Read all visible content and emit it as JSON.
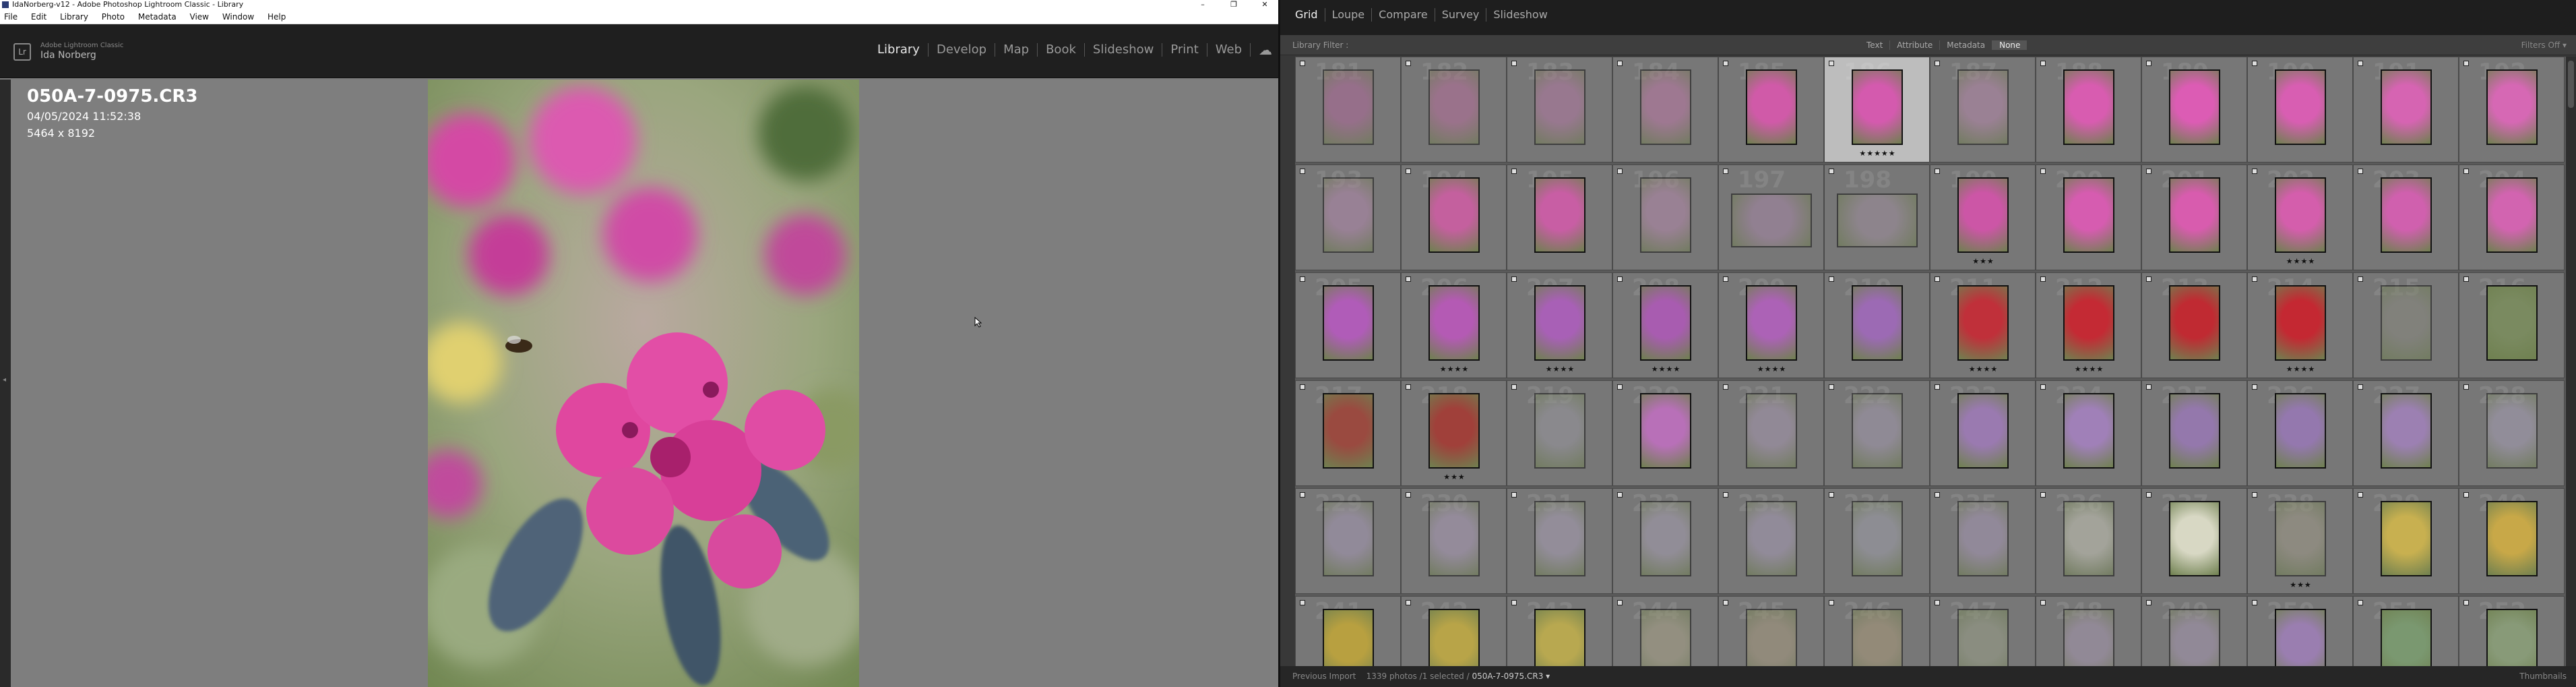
{
  "left_window": {
    "title": "IdaNorberg-v12 - Adobe Photoshop Lightroom Classic - Library",
    "window_buttons": [
      "–",
      "❐",
      "✕"
    ],
    "menu": [
      "File",
      "Edit",
      "Library",
      "Photo",
      "Metadata",
      "View",
      "Window",
      "Help"
    ],
    "identity": {
      "logo": "Lr",
      "sub": "Adobe Lightroom Classic",
      "name": "Ida Norberg"
    },
    "modules": [
      "Library",
      "Develop",
      "Map",
      "Book",
      "Slideshow",
      "Print",
      "Web"
    ],
    "active_module": "Library",
    "cloud_icon": "☁",
    "loupe": {
      "filename": "050A-7-0975.CR3",
      "datetime": "04/05/2024 11:52:38",
      "dimensions": "5464 x 8192"
    }
  },
  "right_window": {
    "view_tabs": [
      "Grid",
      "Loupe",
      "Compare",
      "Survey",
      "Slideshow"
    ],
    "active_view": "Grid",
    "filter_bar": {
      "label": "Library Filter :",
      "options": [
        "Text",
        "Attribute",
        "Metadata",
        "None"
      ],
      "active": "None",
      "right": "Filters Off ▾"
    },
    "status": {
      "source": "Previous Import",
      "count": "1339 photos /1 selected /",
      "file": "050A-7-0975.CR3 ▾"
    },
    "thumbnails_label": "Thumbnails",
    "rows": [
      [
        {
          "n": "181",
          "c": "#b06a9a",
          "o": "p",
          "d": true,
          "s": ""
        },
        {
          "n": "182",
          "c": "#b86f9c",
          "o": "p",
          "d": true,
          "s": ""
        },
        {
          "n": "183",
          "c": "#b47aa4",
          "o": "p",
          "d": true,
          "s": ""
        },
        {
          "n": "184",
          "c": "#bf7aa8",
          "o": "p",
          "d": true,
          "s": ""
        },
        {
          "n": "185",
          "c": "#d05aa8",
          "o": "p",
          "d": false,
          "s": ""
        },
        {
          "n": "186",
          "c": "#d45aae",
          "o": "p",
          "d": false,
          "s": "★★★★★",
          "sel": true
        },
        {
          "n": "187",
          "c": "#b88aac",
          "o": "p",
          "d": true,
          "s": ""
        },
        {
          "n": "188",
          "c": "#d85cb0",
          "o": "p",
          "d": false,
          "s": ""
        },
        {
          "n": "189",
          "c": "#dc5cb4",
          "o": "p",
          "d": false,
          "s": ""
        },
        {
          "n": "190",
          "c": "#d85eb2",
          "o": "p",
          "d": false,
          "s": ""
        },
        {
          "n": "191",
          "c": "#d664b2",
          "o": "p",
          "d": false,
          "s": ""
        },
        {
          "n": "192",
          "c": "#d668b4",
          "o": "p",
          "d": false,
          "s": ""
        }
      ],
      [
        {
          "n": "193",
          "c": "#b48aae",
          "o": "p",
          "d": true,
          "s": ""
        },
        {
          "n": "194",
          "c": "#c4609e",
          "o": "p",
          "d": false,
          "s": ""
        },
        {
          "n": "195",
          "c": "#c85ea4",
          "o": "p",
          "d": false,
          "s": ""
        },
        {
          "n": "196",
          "c": "#b68aac",
          "o": "p",
          "d": true,
          "s": ""
        },
        {
          "n": "197",
          "c": "#a888a8",
          "o": "l",
          "d": true,
          "s": ""
        },
        {
          "n": "198",
          "c": "#a0909e",
          "o": "l",
          "d": true,
          "s": ""
        },
        {
          "n": "199",
          "c": "#cc56a6",
          "o": "p",
          "d": false,
          "s": "★★★"
        },
        {
          "n": "200",
          "c": "#d65cb0",
          "o": "p",
          "d": false,
          "s": ""
        },
        {
          "n": "201",
          "c": "#d85cae",
          "o": "p",
          "d": false,
          "s": ""
        },
        {
          "n": "202",
          "c": "#d45eac",
          "o": "p",
          "d": false,
          "s": "★★★★"
        },
        {
          "n": "203",
          "c": "#d060ae",
          "o": "p",
          "d": false,
          "s": ""
        },
        {
          "n": "204",
          "c": "#d264b0",
          "o": "p",
          "d": false,
          "s": ""
        }
      ],
      [
        {
          "n": "205",
          "c": "#b05cb8",
          "o": "p",
          "d": false,
          "s": ""
        },
        {
          "n": "206",
          "c": "#b45ab4",
          "o": "p",
          "d": false,
          "s": "★★★★"
        },
        {
          "n": "207",
          "c": "#a860b6",
          "o": "p",
          "d": false,
          "s": "★★★★"
        },
        {
          "n": "208",
          "c": "#a85cb0",
          "o": "p",
          "d": false,
          "s": "★★★★"
        },
        {
          "n": "209",
          "c": "#ac62b6",
          "o": "p",
          "d": false,
          "s": "★★★★"
        },
        {
          "n": "210",
          "c": "#9c6ab4",
          "o": "p",
          "d": false,
          "s": ""
        },
        {
          "n": "211",
          "c": "#c0303a",
          "o": "p",
          "d": false,
          "s": "★★★★"
        },
        {
          "n": "212",
          "c": "#c42a34",
          "o": "p",
          "d": false,
          "s": "★★★★"
        },
        {
          "n": "213",
          "c": "#c02a32",
          "o": "p",
          "d": false,
          "s": ""
        },
        {
          "n": "214",
          "c": "#c42832",
          "o": "p",
          "d": false,
          "s": "★★★★"
        },
        {
          "n": "215",
          "c": "#8a8a80",
          "o": "p",
          "d": true,
          "s": ""
        },
        {
          "n": "216",
          "c": "#7a8a60",
          "o": "p",
          "d": false,
          "s": ""
        }
      ],
      [
        {
          "n": "217",
          "c": "#9a4a40",
          "o": "p",
          "d": false,
          "s": ""
        },
        {
          "n": "218",
          "c": "#a0403a",
          "o": "p",
          "d": false,
          "s": "★★★"
        },
        {
          "n": "219",
          "c": "#9a98a0",
          "o": "p",
          "d": true,
          "s": ""
        },
        {
          "n": "220",
          "c": "#b870b8",
          "o": "p",
          "d": false,
          "s": ""
        },
        {
          "n": "221",
          "c": "#a898b0",
          "o": "p",
          "d": true,
          "s": ""
        },
        {
          "n": "222",
          "c": "#a49aae",
          "o": "p",
          "d": true,
          "s": ""
        },
        {
          "n": "223",
          "c": "#9a7ab0",
          "o": "p",
          "d": false,
          "s": ""
        },
        {
          "n": "224",
          "c": "#a080b8",
          "o": "p",
          "d": false,
          "s": ""
        },
        {
          "n": "225",
          "c": "#9478ac",
          "o": "p",
          "d": false,
          "s": ""
        },
        {
          "n": "226",
          "c": "#9478ae",
          "o": "p",
          "d": false,
          "s": ""
        },
        {
          "n": "227",
          "c": "#9c80b2",
          "o": "p",
          "d": false,
          "s": ""
        },
        {
          "n": "228",
          "c": "#a8a0b6",
          "o": "p",
          "d": true,
          "s": ""
        }
      ],
      [
        {
          "n": "229",
          "c": "#a89ab6",
          "o": "p",
          "d": true,
          "s": ""
        },
        {
          "n": "230",
          "c": "#ac9cb8",
          "o": "p",
          "d": true,
          "s": ""
        },
        {
          "n": "231",
          "c": "#aaa0b6",
          "o": "p",
          "d": true,
          "s": ""
        },
        {
          "n": "232",
          "c": "#a8a0b2",
          "o": "p",
          "d": true,
          "s": ""
        },
        {
          "n": "233",
          "c": "#a89cb6",
          "o": "p",
          "d": true,
          "s": ""
        },
        {
          "n": "234",
          "c": "#a0a0aa",
          "o": "p",
          "d": true,
          "s": ""
        },
        {
          "n": "235",
          "c": "#a898b6",
          "o": "p",
          "d": true,
          "s": ""
        },
        {
          "n": "236",
          "c": "#c8c8b8",
          "o": "p",
          "d": true,
          "s": ""
        },
        {
          "n": "237",
          "c": "#d8d8c4",
          "o": "p",
          "d": false,
          "s": ""
        },
        {
          "n": "238",
          "c": "#a09a88",
          "o": "p",
          "d": true,
          "s": "★★★"
        },
        {
          "n": "239",
          "c": "#c8b050",
          "o": "p",
          "d": false,
          "s": ""
        },
        {
          "n": "240",
          "c": "#c8a848",
          "o": "p",
          "d": false,
          "s": ""
        }
      ],
      [
        {
          "n": "241",
          "c": "#b8a040",
          "o": "p",
          "d": false,
          "s": ""
        },
        {
          "n": "242",
          "c": "#b8a448",
          "o": "p",
          "d": false,
          "s": ""
        },
        {
          "n": "243",
          "c": "#b8a850",
          "o": "p",
          "d": false,
          "s": ""
        },
        {
          "n": "244",
          "c": "#aaa488",
          "o": "p",
          "d": true,
          "s": ""
        },
        {
          "n": "245",
          "c": "#a89a80",
          "o": "p",
          "d": true,
          "s": ""
        },
        {
          "n": "246",
          "c": "#aa9a7a",
          "o": "p",
          "d": true,
          "s": ""
        },
        {
          "n": "247",
          "c": "#9aa088",
          "o": "p",
          "d": true,
          "s": ""
        },
        {
          "n": "248",
          "c": "#a898b0",
          "o": "p",
          "d": true,
          "s": ""
        },
        {
          "n": "249",
          "c": "#a898b2",
          "o": "p",
          "d": true,
          "s": ""
        },
        {
          "n": "250",
          "c": "#9a7eb0",
          "o": "p",
          "d": false,
          "s": ""
        },
        {
          "n": "251",
          "c": "#7a9870",
          "o": "p",
          "d": false,
          "s": ""
        },
        {
          "n": "252",
          "c": "#889a78",
          "o": "p",
          "d": false,
          "s": ""
        }
      ]
    ]
  }
}
